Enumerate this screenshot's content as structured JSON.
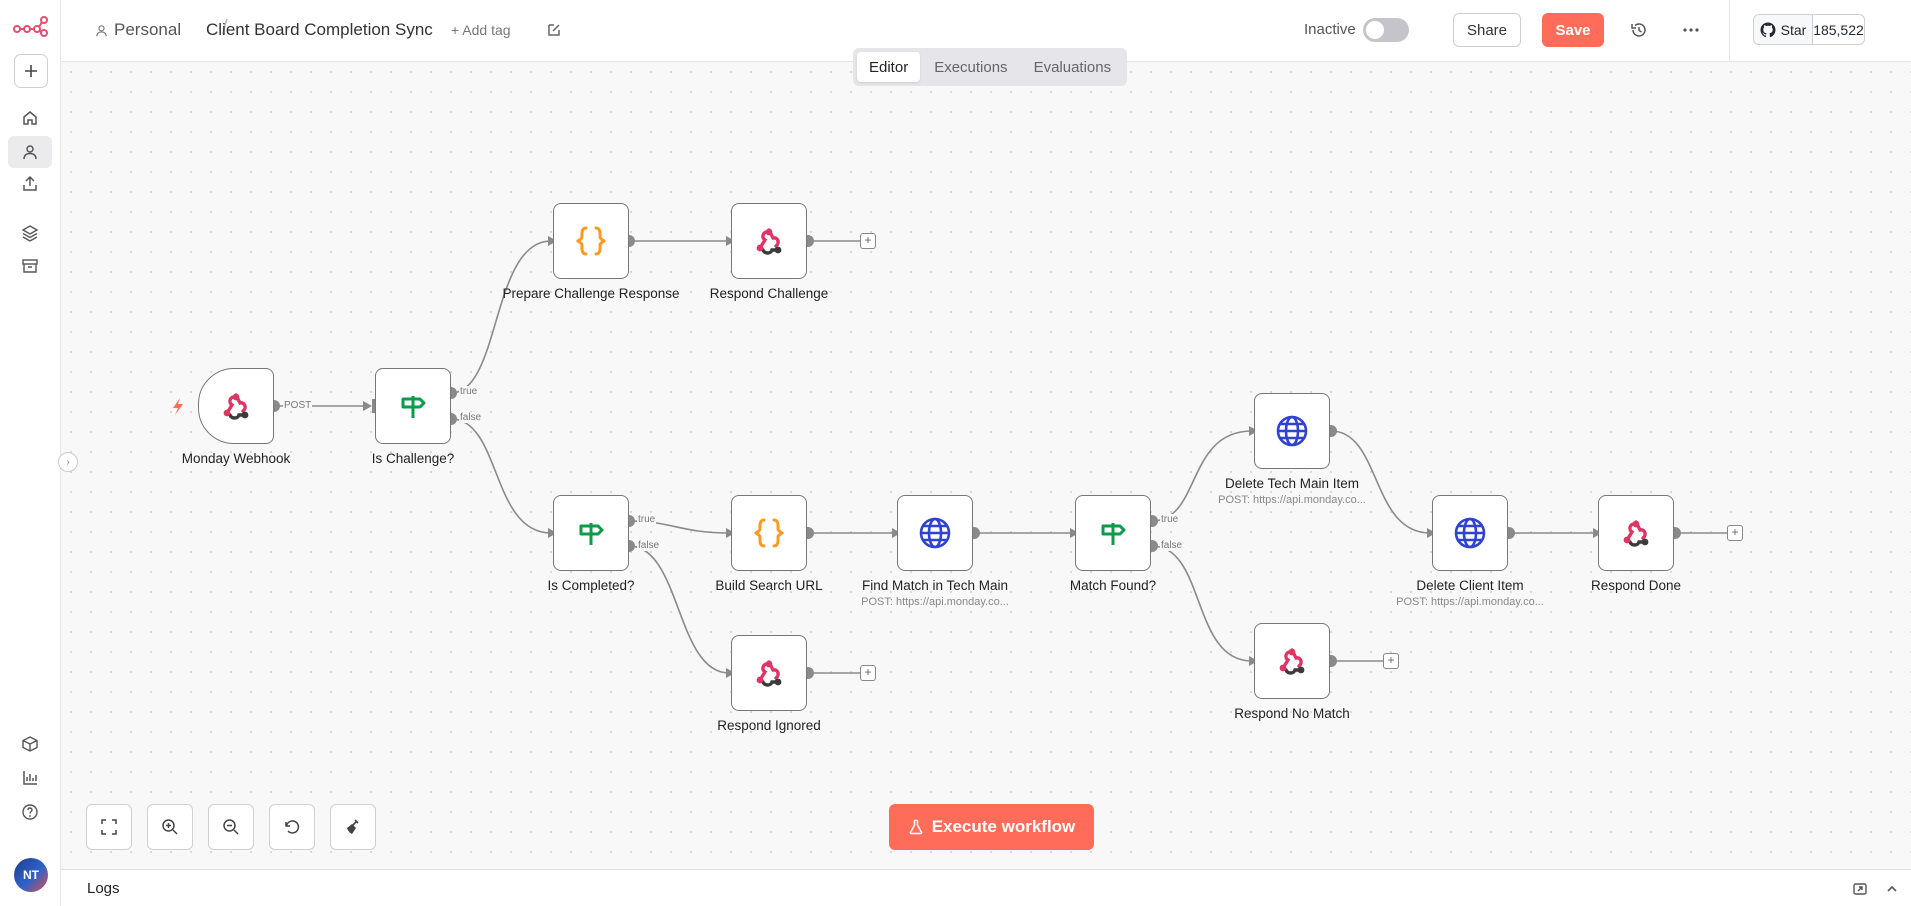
{
  "header": {
    "project": "Personal",
    "separator": "/",
    "title": "Client Board Completion Sync",
    "add_tag": "+ Add tag",
    "status_label": "Inactive",
    "share_label": "Share",
    "save_label": "Save",
    "github_star_label": "Star",
    "github_star_count": "185,522"
  },
  "tabs": [
    {
      "label": "Editor",
      "active": true
    },
    {
      "label": "Executions",
      "active": false
    },
    {
      "label": "Evaluations",
      "active": false
    }
  ],
  "nodes": {
    "monday_webhook": {
      "label": "Monday Webhook",
      "icon": "webhook-icon"
    },
    "is_challenge": {
      "label": "Is Challenge?",
      "icon": "if-signpost-icon"
    },
    "prepare_challenge": {
      "label": "Prepare Challenge Response",
      "icon": "code-braces-icon"
    },
    "respond_challenge": {
      "label": "Respond Challenge",
      "icon": "webhook-icon"
    },
    "is_completed": {
      "label": "Is Completed?",
      "icon": "if-signpost-icon"
    },
    "build_search_url": {
      "label": "Build Search URL",
      "icon": "code-braces-icon"
    },
    "find_match": {
      "label": "Find Match in Tech Main",
      "sub": "POST: https://api.monday.co...",
      "icon": "globe-icon"
    },
    "match_found": {
      "label": "Match Found?",
      "icon": "if-signpost-icon"
    },
    "delete_tech": {
      "label": "Delete Tech Main Item",
      "sub": "POST: https://api.monday.co...",
      "icon": "globe-icon"
    },
    "delete_client": {
      "label": "Delete Client Item",
      "sub": "POST: https://api.monday.co...",
      "icon": "globe-icon"
    },
    "respond_done": {
      "label": "Respond Done",
      "icon": "webhook-icon"
    },
    "respond_ignored": {
      "label": "Respond Ignored",
      "icon": "webhook-icon"
    },
    "respond_no_match": {
      "label": "Respond No Match",
      "icon": "webhook-icon"
    }
  },
  "edge_labels": {
    "post": "POST",
    "true": "true",
    "false": "false"
  },
  "execute_label": "Execute workflow",
  "logs_label": "Logs",
  "user_initials": "NT",
  "colors": {
    "accent": "#ff6d5a",
    "if_green": "#0c9a4b",
    "code_orange": "#ff9922",
    "http_blue": "#2f42d1",
    "webhook_pink": "#dd3665"
  }
}
